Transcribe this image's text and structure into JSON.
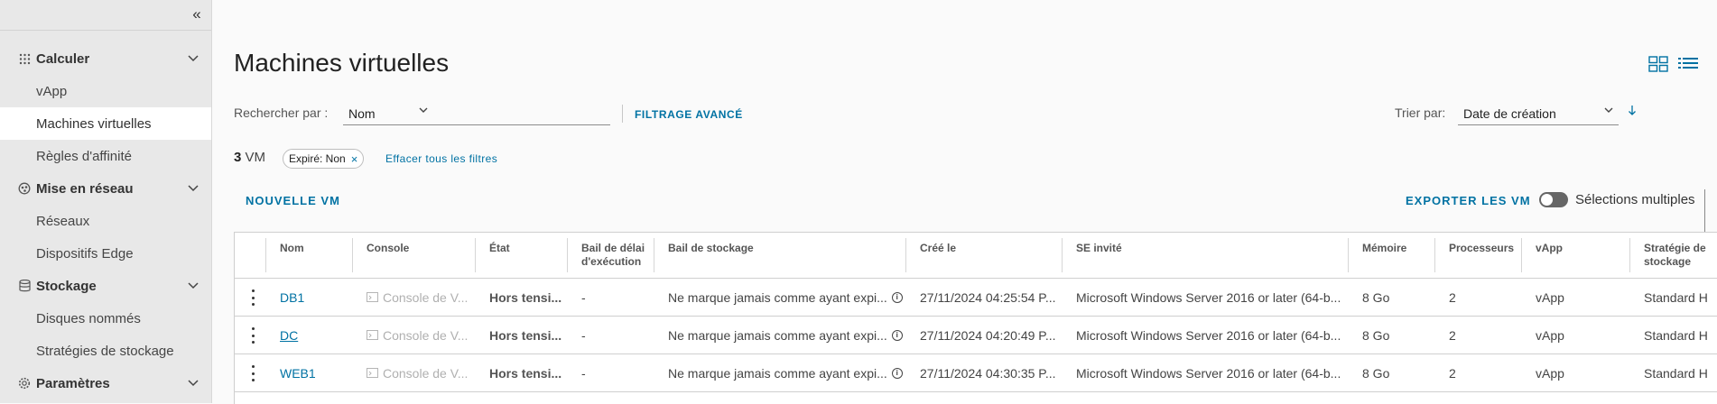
{
  "sidebar": {
    "groups": [
      {
        "label": "Calculer",
        "icon": "grid-dots-icon",
        "items": [
          {
            "label": "vApp",
            "active": false
          },
          {
            "label": "Machines virtuelles",
            "active": true
          },
          {
            "label": "Règles d'affinité",
            "active": false
          }
        ]
      },
      {
        "label": "Mise en réseau",
        "icon": "network-icon",
        "items": [
          {
            "label": "Réseaux",
            "active": false
          },
          {
            "label": "Dispositifs Edge",
            "active": false
          }
        ]
      },
      {
        "label": "Stockage",
        "icon": "database-icon",
        "items": [
          {
            "label": "Disques nommés",
            "active": false
          },
          {
            "label": "Stratégies de stockage",
            "active": false
          }
        ]
      },
      {
        "label": "Paramètres",
        "icon": "gear-icon",
        "items": []
      }
    ]
  },
  "page": {
    "title": "Machines virtuelles"
  },
  "search": {
    "label": "Rechercher par :",
    "field": "Nom"
  },
  "filters": {
    "advanced_label": "FILTRAGE AVANCÉ",
    "chip_label": "Expiré: Non",
    "clear_label": "Effacer tous les filtres"
  },
  "sort": {
    "label": "Trier par:",
    "value": "Date de création"
  },
  "count": {
    "number": "3",
    "unit": "VM"
  },
  "actions": {
    "new_vm": "NOUVELLE VM",
    "export_vm": "EXPORTER LES VM",
    "multi_select": "Sélections multiples",
    "multi_select_on": false
  },
  "table": {
    "headers": [
      "Nom",
      "Console",
      "État",
      "Bail de délai d'exécution",
      "Bail de stockage",
      "Créé le",
      "SE invité",
      "Mémoire",
      "Processeurs",
      "vApp",
      "Stratégie de stockage"
    ],
    "rows": [
      {
        "name": "DB1",
        "console": "Console de V...",
        "state": "Hors tensi...",
        "runtime_lease": "-",
        "storage_lease": "Ne marque jamais comme ayant expi...",
        "created": "27/11/2024 04:25:54 P...",
        "guest_os": "Microsoft Windows Server 2016 or later (64-b...",
        "memory": "8 Go",
        "cpus": "2",
        "vapp": "vApp",
        "storage_policy": "Standard H"
      },
      {
        "name": "DC",
        "console": "Console de V...",
        "state": "Hors tensi...",
        "runtime_lease": "-",
        "storage_lease": "Ne marque jamais comme ayant expi...",
        "created": "27/11/2024 04:20:49 P...",
        "guest_os": "Microsoft Windows Server 2016 or later (64-b...",
        "memory": "8 Go",
        "cpus": "2",
        "vapp": "vApp",
        "storage_policy": "Standard H"
      },
      {
        "name": "WEB1",
        "console": "Console de V...",
        "state": "Hors tensi...",
        "runtime_lease": "-",
        "storage_lease": "Ne marque jamais comme ayant expi...",
        "created": "27/11/2024 04:30:35 P...",
        "guest_os": "Microsoft Windows Server 2016 or later (64-b...",
        "memory": "8 Go",
        "cpus": "2",
        "vapp": "vApp",
        "storage_policy": "Standard H"
      }
    ]
  },
  "colors": {
    "accent": "#0072a3",
    "sidebar_bg": "#e8e8e8",
    "active_bg": "#ffffff"
  }
}
